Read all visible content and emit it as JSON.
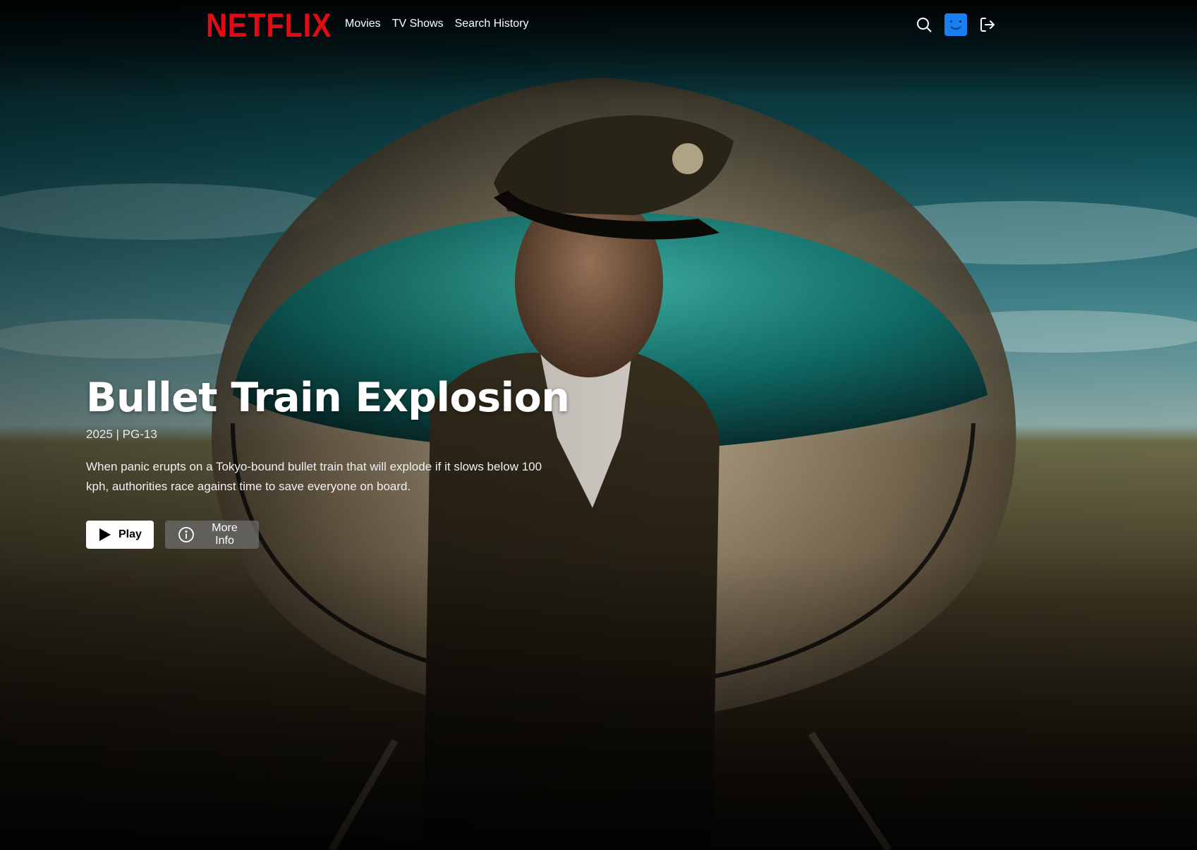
{
  "brand": {
    "logo_text": "NETFLIX",
    "logo_color": "#e50914"
  },
  "nav": {
    "links": [
      {
        "label": "Movies"
      },
      {
        "label": "TV Shows"
      },
      {
        "label": "Search History"
      }
    ],
    "icons": {
      "search": "search-icon",
      "avatar": "profile-avatar-icon",
      "logout": "logout-icon"
    },
    "avatar_color": "#1a7ff0"
  },
  "hero": {
    "title": "Bullet Train Explosion",
    "meta": "2025 | PG-13",
    "description": "When panic erupts on a Tokyo-bound bullet train that will explode if it slows below 100 kph, authorities race against time to save everyone on board.",
    "play_label": "Play",
    "more_info_label": "More Info",
    "play_icon": "play-icon",
    "info_icon": "info-circle-icon"
  }
}
